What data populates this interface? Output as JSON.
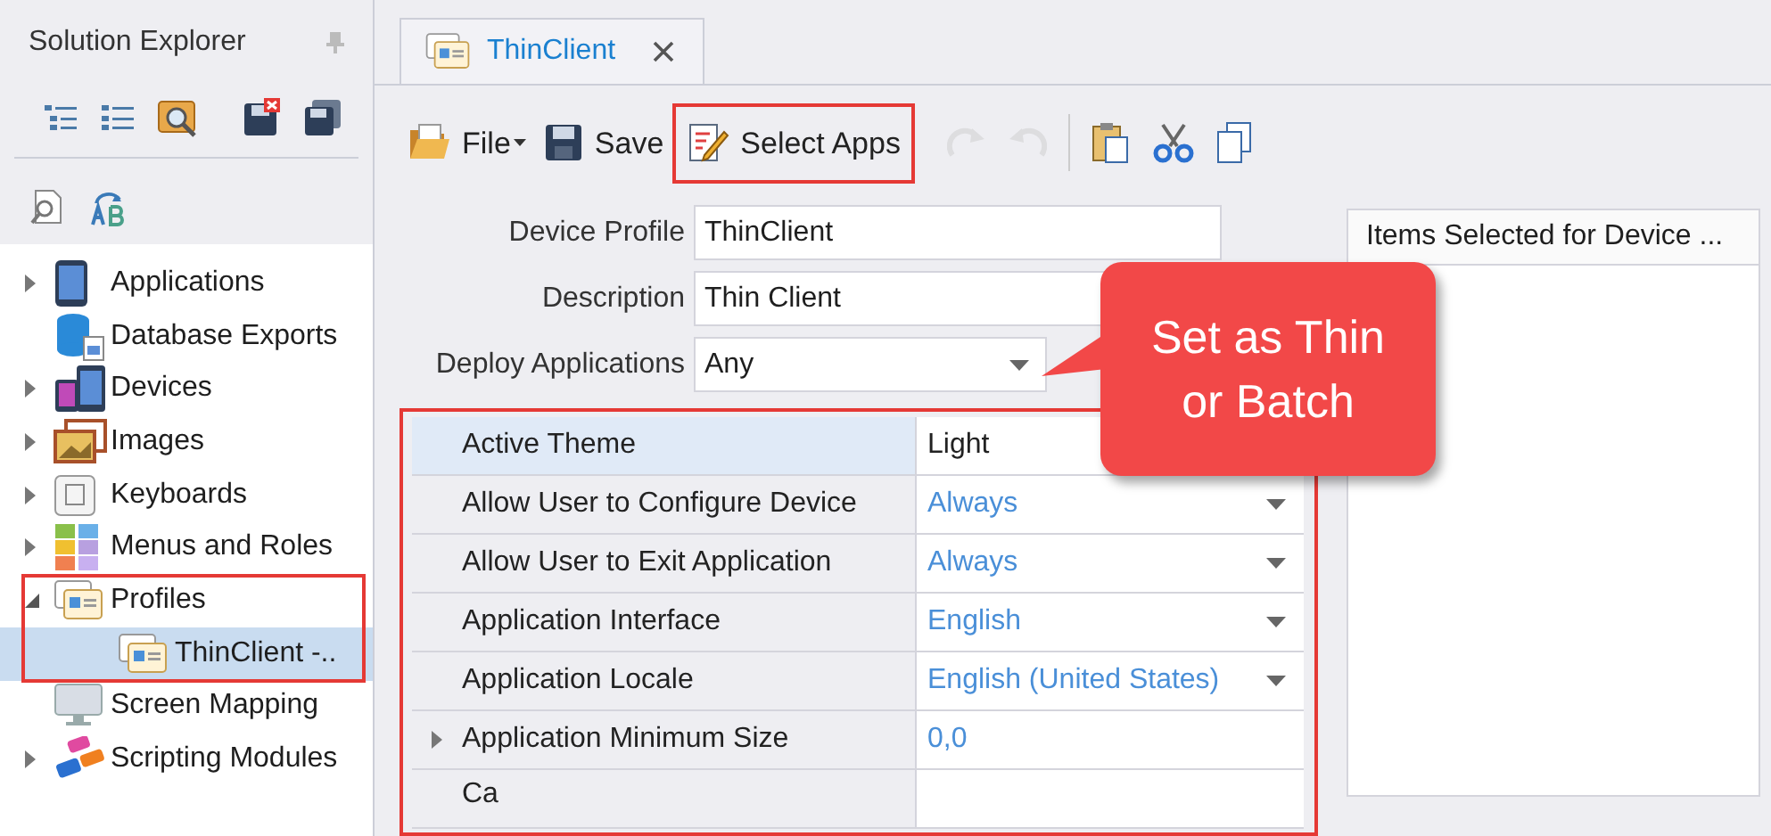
{
  "sidebar": {
    "title": "Solution Explorer",
    "tree": [
      {
        "label": "Applications",
        "expandable": true,
        "expanded": false,
        "selected": false
      },
      {
        "label": "Database Exports",
        "expandable": false,
        "selected": false
      },
      {
        "label": "Devices",
        "expandable": true,
        "expanded": false,
        "selected": false
      },
      {
        "label": "Images",
        "expandable": true,
        "expanded": false,
        "selected": false
      },
      {
        "label": "Keyboards",
        "expandable": true,
        "expanded": false,
        "selected": false
      },
      {
        "label": "Menus and Roles",
        "expandable": true,
        "expanded": false,
        "selected": false
      },
      {
        "label": "Profiles",
        "expandable": true,
        "expanded": true,
        "selected": false,
        "children": [
          {
            "label": "ThinClient -..",
            "expandable": false,
            "selected": true
          }
        ]
      },
      {
        "label": "Screen Mapping",
        "expandable": false,
        "selected": false
      },
      {
        "label": "Scripting Modules",
        "expandable": true,
        "expanded": false,
        "selected": false
      }
    ]
  },
  "tabs": [
    {
      "label": "ThinClient",
      "selected": true
    }
  ],
  "toolbar": {
    "buttons": [
      {
        "label": "File",
        "menu": true
      },
      {
        "label": "Save",
        "menu": false
      },
      {
        "label": "Select Apps",
        "menu": false
      }
    ],
    "icon_buttons": [
      {
        "disabled": true
      },
      {
        "disabled": true
      },
      {
        "disabled": false
      },
      {
        "disabled": false
      },
      {
        "disabled": false
      }
    ]
  },
  "form": [
    {
      "label": "Device Profile",
      "value": "ThinClient",
      "kind": "text"
    },
    {
      "label": "Description",
      "value": "Thin Client",
      "kind": "text"
    },
    {
      "label": "Deploy Applications",
      "value": "Any",
      "kind": "dropdown"
    }
  ],
  "properties": [
    {
      "name": "Active Theme",
      "value": "Light",
      "kind": "static",
      "default": false,
      "selected": true
    },
    {
      "name": "Allow User to Configure Device",
      "value": "Always",
      "kind": "dropdown",
      "default": true,
      "selected": false
    },
    {
      "name": "Allow User to Exit Application",
      "value": "Always",
      "kind": "dropdown",
      "default": true,
      "selected": false
    },
    {
      "name": "Application Interface",
      "value": "English",
      "kind": "dropdown",
      "default": true,
      "selected": false
    },
    {
      "name": "Application Locale",
      "value": "English (United States)",
      "kind": "dropdown",
      "default": true,
      "selected": false
    },
    {
      "name": "Application Minimum Size",
      "value": "0,0",
      "kind": "expandable",
      "default": true,
      "selected": false
    },
    {
      "name": "Ca",
      "kind": "static",
      "selected": false
    }
  ],
  "selected_items": {
    "header": "Items Selected for Device ..."
  },
  "callout": {
    "text": "Set as Thin\nor Batch"
  }
}
